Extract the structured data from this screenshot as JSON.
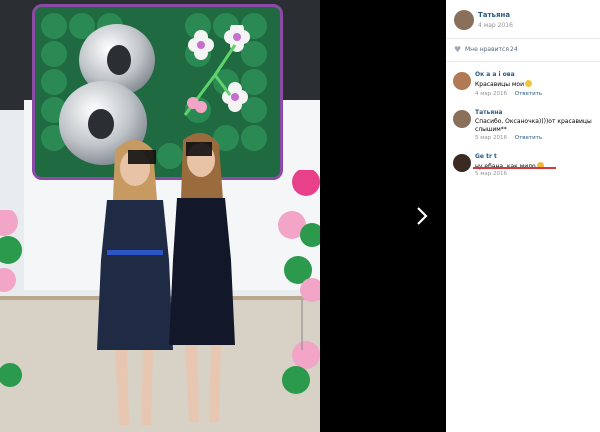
{
  "post": {
    "author": "Татьяна",
    "date": "4 мар 2016"
  },
  "likes": {
    "label": "Мне нравится",
    "count": "24"
  },
  "comments": [
    {
      "author": "Ок а  а і   ова",
      "text": "Красавицы мои",
      "date": "4 мар 2016",
      "reply": "Ответить"
    },
    {
      "author": "Татьяна",
      "text": "Спасибо, Оксаночка))))от красавицы слышим**",
      "date": "5 мар 2016",
      "reply": "Ответить"
    },
    {
      "author": "Ge     tr t",
      "text": "ну ебана, как мило",
      "date": "5 мар 2016",
      "reply": ""
    }
  ],
  "viewer": {
    "next_icon": "chevron-right-icon"
  },
  "colors": {
    "link": "#2a5885",
    "muted": "#939393",
    "accent_underline": "#d23b3b"
  }
}
